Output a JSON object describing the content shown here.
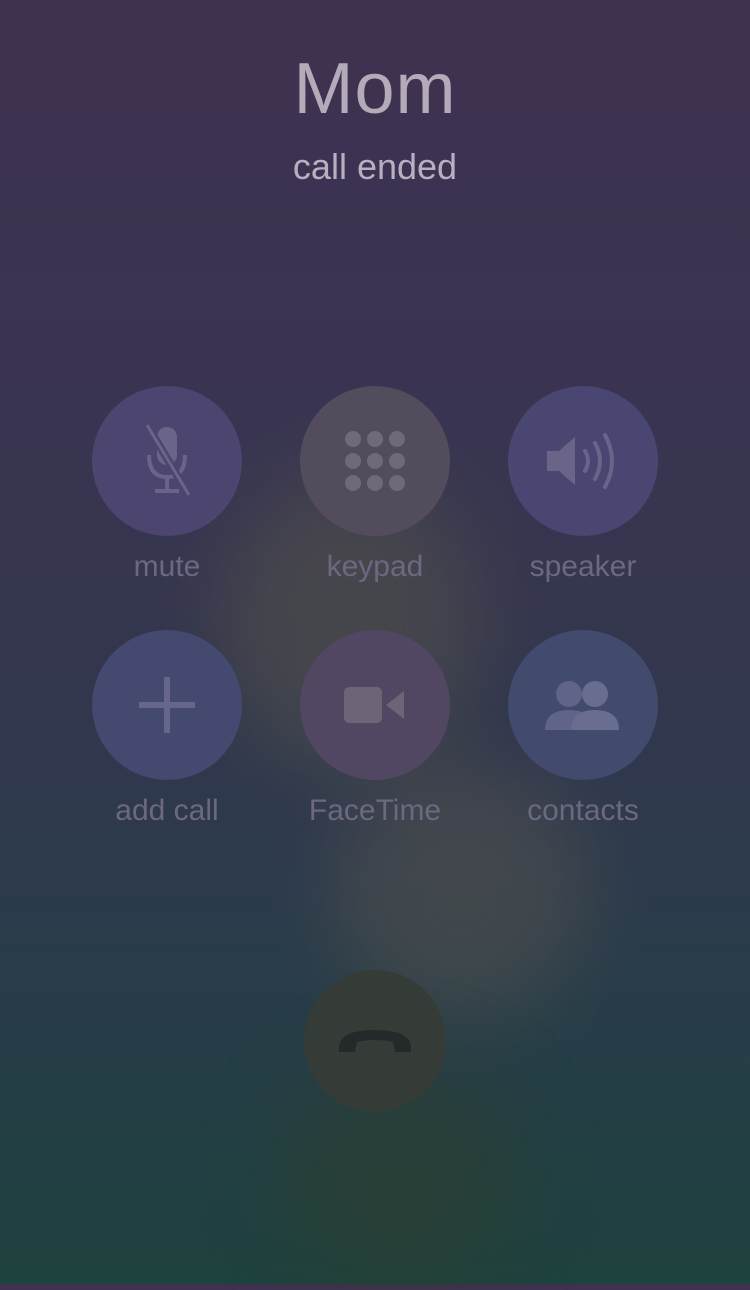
{
  "caller": {
    "name": "Mom",
    "status": "call ended"
  },
  "buttons": {
    "mute": {
      "label": "mute",
      "icon": "microphone-muted-icon"
    },
    "keypad": {
      "label": "keypad",
      "icon": "keypad-icon"
    },
    "speaker": {
      "label": "speaker",
      "icon": "speaker-icon"
    },
    "add_call": {
      "label": "add call",
      "icon": "plus-icon"
    },
    "facetime": {
      "label": "FaceTime",
      "icon": "video-camera-icon"
    },
    "contacts": {
      "label": "contacts",
      "icon": "contacts-icon"
    }
  },
  "end_call": {
    "icon": "phone-hangup-icon"
  },
  "colors": {
    "background_top": "#3f3150",
    "background_bottom": "#1e423e",
    "icon": "#6a6588",
    "label": "#6c6881"
  }
}
